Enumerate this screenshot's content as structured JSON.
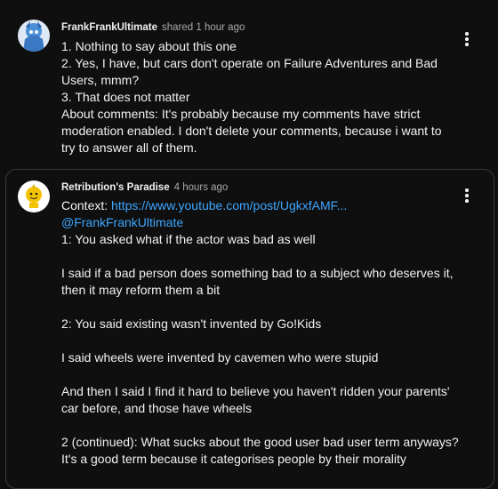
{
  "comments": [
    {
      "author": "FrankFrankUltimate",
      "time": "shared 1 hour ago",
      "lines": [
        "1. Nothing to say about this one",
        "2. Yes, I have, but cars don't operate on Failure Adventures and Bad",
        "Users, mmm?",
        "3. That does not matter",
        "About comments: It's probably because my comments have strict",
        "moderation enabled. I don't delete your comments, because i want to",
        "try to answer all of them."
      ]
    },
    {
      "author": "Retribution's Paradise",
      "time": "4 hours ago",
      "context_label": "Context: ",
      "context_link": "https://www.youtube.com/post/UgkxfAMF...",
      "mention": "@FrankFrankUltimate",
      "lines": [
        "1: You asked what if the actor was bad as well",
        "",
        "I said if a bad person does something bad to a subject who deserves it,",
        "then it may reform them a bit",
        "",
        "2: You said existing wasn't invented by Go!Kids",
        "",
        "I said wheels were invented by cavemen who were stupid",
        "",
        "And then I said I find it hard to believe you haven't ridden your parents'",
        "car before, and those have wheels",
        "",
        "2 (continued): What sucks about the good user bad user term anyways?",
        "It's a good term because it categorises people by their morality"
      ]
    }
  ],
  "colors": {
    "background": "#0f0f0f",
    "link": "#3ea6ff",
    "secondary_text": "#aaaaaa"
  }
}
